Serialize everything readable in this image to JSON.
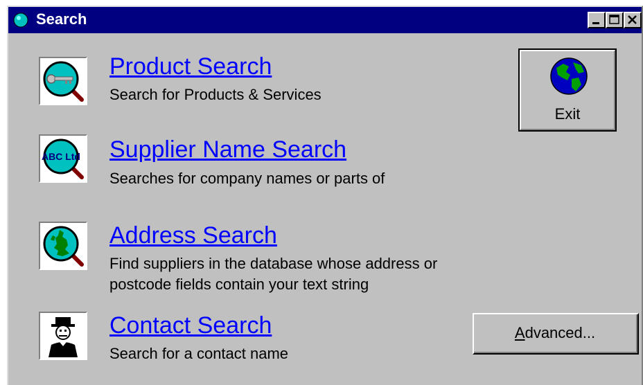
{
  "window": {
    "title": "Search",
    "controls": [
      "minimize",
      "maximize",
      "close"
    ]
  },
  "searches": [
    {
      "title": "Product Search",
      "description": [
        "Search for Products & Services"
      ],
      "icon": "magnifier-key-icon"
    },
    {
      "title": "Supplier Name Search",
      "description": [
        "Searches for company names or parts of"
      ],
      "icon": "magnifier-abc-ltd-icon",
      "icon_text": "ABC Ltd"
    },
    {
      "title": "Address Search",
      "description": [
        "Find suppliers in the database whose address or",
        "postcode fields contain your text string"
      ],
      "icon": "magnifier-map-icon"
    },
    {
      "title": "Contact Search",
      "description": [
        "Search for a contact name"
      ],
      "icon": "person-icon"
    }
  ],
  "buttons": {
    "exit": {
      "label": "Exit",
      "icon": "globe-icon"
    },
    "advanced": {
      "mnemonic": "A",
      "rest": "dvanced..."
    }
  },
  "colors": {
    "titlebar": "#000080",
    "face": "#c0c0c0",
    "link": "#0000ff"
  }
}
